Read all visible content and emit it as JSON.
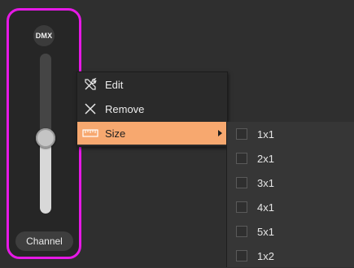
{
  "fader": {
    "badge": "DMX",
    "channel_label": "Channel",
    "level": 0.47,
    "border_color": "#e619e6"
  },
  "context_menu": {
    "items": [
      {
        "label": "Edit",
        "icon": "tools-icon"
      },
      {
        "label": "Remove",
        "icon": "close-icon"
      },
      {
        "label": "Size",
        "icon": "ruler-icon",
        "active": true,
        "has_submenu": true
      }
    ],
    "active_color": "#f7a86f"
  },
  "size_submenu": {
    "options": [
      "1x1",
      "2x1",
      "3x1",
      "4x1",
      "5x1",
      "1x2"
    ]
  }
}
